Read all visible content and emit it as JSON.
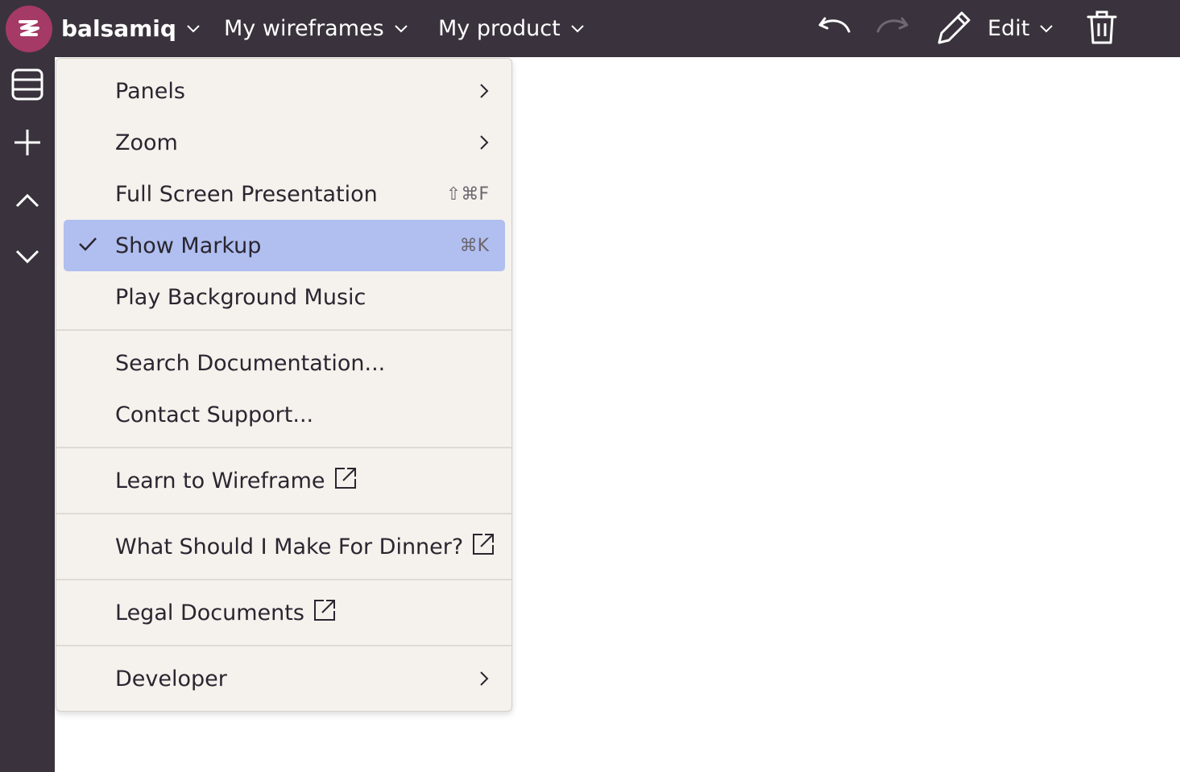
{
  "topbar": {
    "brand": "balsamiq",
    "menus": [
      "My wireframes",
      "My product"
    ],
    "edit_label": "Edit",
    "icons": [
      "undo-icon",
      "redo-icon",
      "pencil-icon",
      "trash-icon"
    ]
  },
  "dropdown": {
    "items": [
      {
        "label": "Panels",
        "right": "submenu"
      },
      {
        "label": "Zoom",
        "right": "submenu"
      },
      {
        "label": "Full Screen Presentation",
        "shortcut": "⇧⌘F"
      },
      {
        "label": "Show Markup",
        "shortcut": "⌘K",
        "checked": true
      },
      {
        "label": "Play Background Music"
      },
      {
        "label": "Search Documentation..."
      },
      {
        "label": "Contact Support..."
      },
      {
        "label": "Learn to Wireframe",
        "external": true
      },
      {
        "label": "What Should I Make For Dinner?",
        "external": true
      },
      {
        "label": "Legal Documents",
        "external": true
      },
      {
        "label": "Developer",
        "right": "submenu"
      }
    ]
  },
  "colors": {
    "topbar": "#3a333d",
    "menu_bg": "#f5f1ec",
    "selected": "#b0bff0",
    "logo": "#a63a66"
  }
}
